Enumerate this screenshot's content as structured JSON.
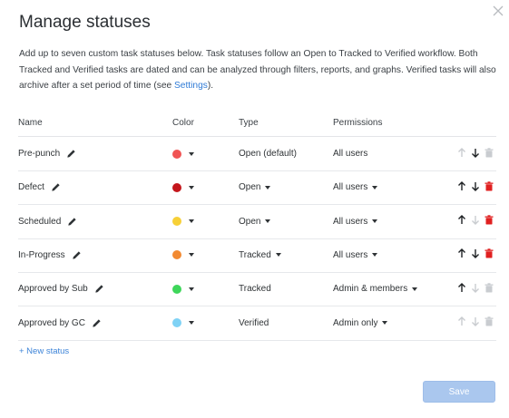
{
  "dialog": {
    "title": "Manage statuses",
    "description_pre": "Add up to seven custom task statuses below. Task statuses follow an Open to Tracked to Verified workflow. Both Tracked and Verified tasks are dated and can be analyzed through filters, reports, and graphs. Verified tasks will also archive after a set period of time (see ",
    "description_link": "Settings",
    "description_post": ")."
  },
  "table": {
    "headers": {
      "name": "Name",
      "color": "Color",
      "type": "Type",
      "permissions": "Permissions"
    },
    "rows": [
      {
        "name": "Pre-punch",
        "color": "#f05454",
        "type": "Open (default)",
        "type_dropdown": false,
        "permissions": "All users",
        "perm_dropdown": false,
        "up_enabled": false,
        "down_enabled": true,
        "delete_enabled": false
      },
      {
        "name": "Defect",
        "color": "#c4161c",
        "type": "Open",
        "type_dropdown": true,
        "permissions": "All users",
        "perm_dropdown": true,
        "up_enabled": true,
        "down_enabled": true,
        "delete_enabled": true
      },
      {
        "name": "Scheduled",
        "color": "#f7d037",
        "type": "Open",
        "type_dropdown": true,
        "permissions": "All users",
        "perm_dropdown": true,
        "up_enabled": true,
        "down_enabled": false,
        "delete_enabled": true
      },
      {
        "name": "In-Progress",
        "color": "#f28a32",
        "type": "Tracked",
        "type_dropdown": true,
        "permissions": "All users",
        "perm_dropdown": true,
        "up_enabled": true,
        "down_enabled": true,
        "delete_enabled": true
      },
      {
        "name": "Approved by Sub",
        "color": "#3ed65a",
        "type": "Tracked",
        "type_dropdown": false,
        "permissions": "Admin & members",
        "perm_dropdown": true,
        "up_enabled": true,
        "down_enabled": false,
        "delete_enabled": false
      },
      {
        "name": "Approved by GC",
        "color": "#7fd2f5",
        "type": "Verified",
        "type_dropdown": false,
        "permissions": "Admin only",
        "perm_dropdown": true,
        "up_enabled": false,
        "down_enabled": false,
        "delete_enabled": false
      }
    ]
  },
  "new_status_label": "+ New status",
  "save_label": "Save",
  "icons": {
    "close": "close-icon",
    "edit": "pencil-icon",
    "up": "arrow-up-icon",
    "down": "arrow-down-icon",
    "delete": "trash-icon"
  },
  "colors": {
    "accent": "#2f7bd6",
    "delete": "#e02020",
    "disabled": "#c9ccd0",
    "save_bg": "#aac7ee"
  }
}
